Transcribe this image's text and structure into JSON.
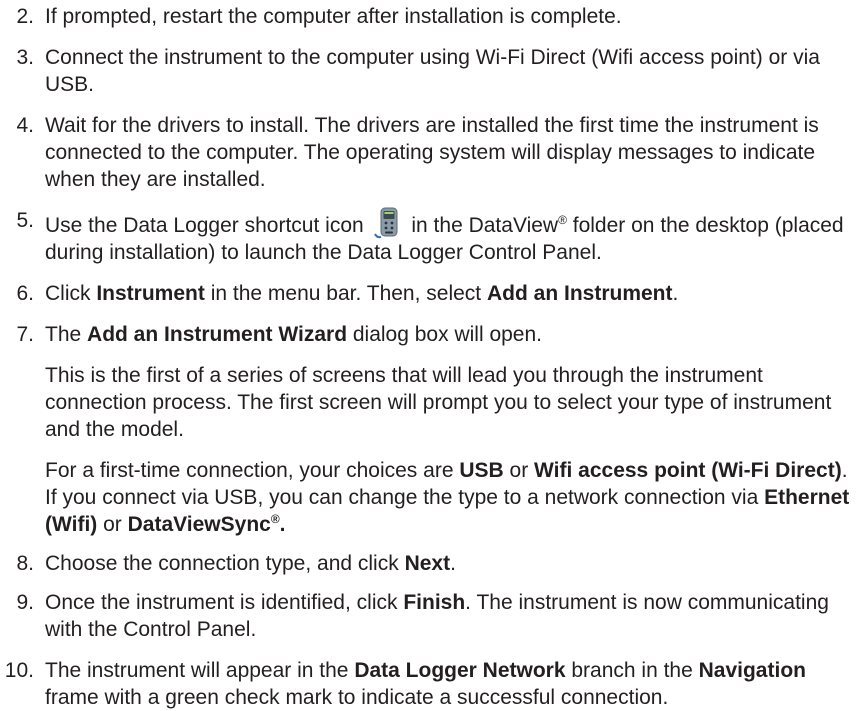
{
  "steps": [
    {
      "num": "2.",
      "text": "If prompted, restart the computer after installation is complete."
    },
    {
      "num": "3.",
      "text": "Connect the instrument to the computer using Wi-Fi Direct (Wifi access point) or via USB."
    },
    {
      "num": "4.",
      "text": "Wait for the drivers to install. The drivers are installed the first time the instrument is connected to the computer. The operating system will display messages to indicate when they are installed."
    },
    {
      "num": "5.",
      "before": "Use the Data Logger shortcut icon",
      "mid": "in the DataView",
      "reg": "®",
      "after": " folder on the desktop (placed during installation) to launch the Data Logger Control Panel.",
      "icon": "data-logger-icon"
    },
    {
      "num": "6.",
      "t1": "Click ",
      "b1": "Instrument",
      "t2": " in the menu bar. Then, select ",
      "b2": "Add an Instrument",
      "t3": "."
    },
    {
      "num": "7.",
      "t1": "The ",
      "b1": "Add an Instrument Wizard",
      "t2": " dialog box will open."
    },
    {
      "num": "8.",
      "t1": "Choose the connection type, and click ",
      "b1": "Next",
      "t2": "."
    },
    {
      "num": "9.",
      "t1": "Once the instrument is identified, click ",
      "b1": "Finish",
      "t2": ". The instrument is now communicating with the Control Panel."
    },
    {
      "num": "10.",
      "t1": "The instrument will appear in the ",
      "b1": "Data Logger Network",
      "t2": " branch in the ",
      "b2": "Navigation",
      "t3": " frame with a green check mark to indicate a successful connection."
    }
  ],
  "step7_para1": "This is the first of a series of screens that will lead you through the instrument connection process. The first screen will prompt you to select your type of instrument and the model.",
  "step7_para2": {
    "t1": "For a first-time connection, your choices are ",
    "b1": "USB",
    "t2": " or ",
    "b2": "Wifi access point (Wi-Fi Direct)",
    "t3": ". If you connect via USB, you can change the type to a network connection via ",
    "b3": "Ethernet (Wifi)",
    "t4": " or ",
    "b4": "DataViewSync",
    "b4reg": "®",
    "b4end": "."
  },
  "colors": {
    "text": "#231f20",
    "icon_body": "#8a9aa6",
    "icon_screen": "#3d4a52",
    "icon_accent": "#2d6fb8"
  }
}
